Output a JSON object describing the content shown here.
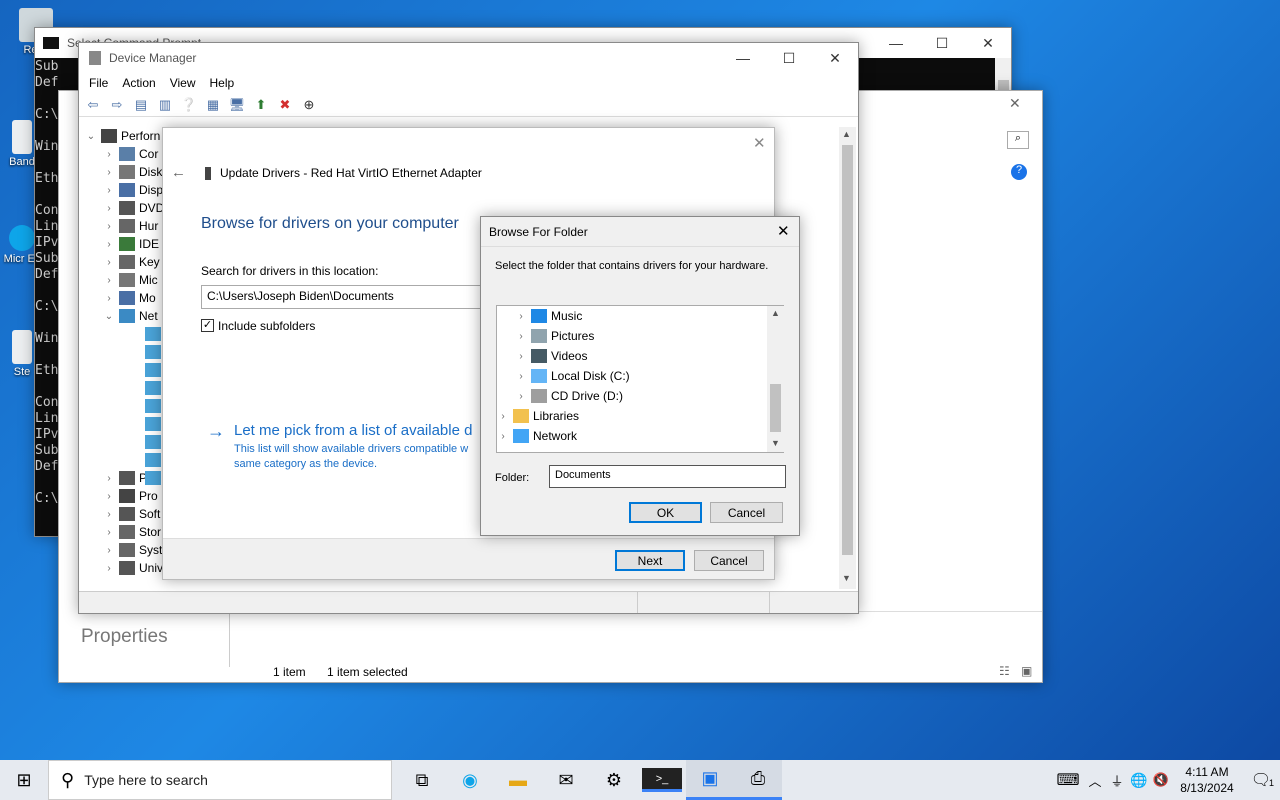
{
  "desktop": {
    "icons": [
      {
        "label": "Recy"
      },
      {
        "label": "Band"
      },
      {
        "label": "Micr Ec"
      },
      {
        "label": "Ste"
      }
    ]
  },
  "cmd": {
    "title": "Select Command Prompt",
    "lines": [
      "Sub",
      "Def",
      "",
      "C:\\Use",
      "",
      "Window",
      "",
      "Etherne",
      "",
      "Con",
      "Lin",
      "IPv",
      "Sub",
      "Def",
      "",
      "C:\\Use",
      "",
      "Window",
      "",
      "Etherne",
      "",
      "Con",
      "Lin",
      "IPv",
      "Sub",
      "Def",
      "",
      "C:\\Use"
    ]
  },
  "explorer": {
    "properties_label": "Properties",
    "status_items": "1 item",
    "status_selected": "1 item selected"
  },
  "device_manager": {
    "title": "Device Manager",
    "menu": [
      "File",
      "Action",
      "View",
      "Help"
    ],
    "tree": [
      {
        "label": "Perforn",
        "expanded": true
      },
      {
        "label": "Cor"
      },
      {
        "label": "Disk"
      },
      {
        "label": "Disp"
      },
      {
        "label": "DVD"
      },
      {
        "label": "Hur"
      },
      {
        "label": "IDE"
      },
      {
        "label": "Key"
      },
      {
        "label": "Mic"
      },
      {
        "label": "Mo"
      },
      {
        "label": "Net"
      },
      {
        "label": "Prin"
      },
      {
        "label": "Pro"
      },
      {
        "label": "Soft"
      },
      {
        "label": "Stor"
      },
      {
        "label": "Syst"
      },
      {
        "label": "Universal Serial Bus controllers"
      }
    ]
  },
  "update_drivers": {
    "title": "Update Drivers - Red Hat VirtIO Ethernet Adapter",
    "heading": "Browse for drivers on your computer",
    "search_label": "Search for drivers in this location:",
    "path_value": "C:\\Users\\Joseph Biden\\Documents",
    "include_subfolders": "Include subfolders",
    "include_checked": true,
    "pick_link": "Let me pick from a list of available d",
    "pick_desc_1": "This list will show available drivers compatible w",
    "pick_desc_2": "same category as the device.",
    "next": "Next",
    "cancel": "Cancel"
  },
  "browse_folder": {
    "title": "Browse For Folder",
    "instruction": "Select the folder that contains drivers for your hardware.",
    "items": [
      {
        "label": "Music",
        "icon": "music-icon"
      },
      {
        "label": "Pictures",
        "icon": "pictures-icon"
      },
      {
        "label": "Videos",
        "icon": "videos-icon"
      },
      {
        "label": "Local Disk (C:)",
        "icon": "drive-icon"
      },
      {
        "label": "CD Drive (D:)",
        "icon": "cd-icon"
      },
      {
        "label": "Libraries",
        "icon": "library-icon"
      },
      {
        "label": "Network",
        "icon": "network-icon"
      }
    ],
    "folder_label": "Folder:",
    "folder_value": "Documents",
    "ok": "OK",
    "cancel": "Cancel"
  },
  "taskbar": {
    "search_placeholder": "Type here to search",
    "time": "4:11 AM",
    "date": "8/13/2024",
    "notifications": "1"
  }
}
